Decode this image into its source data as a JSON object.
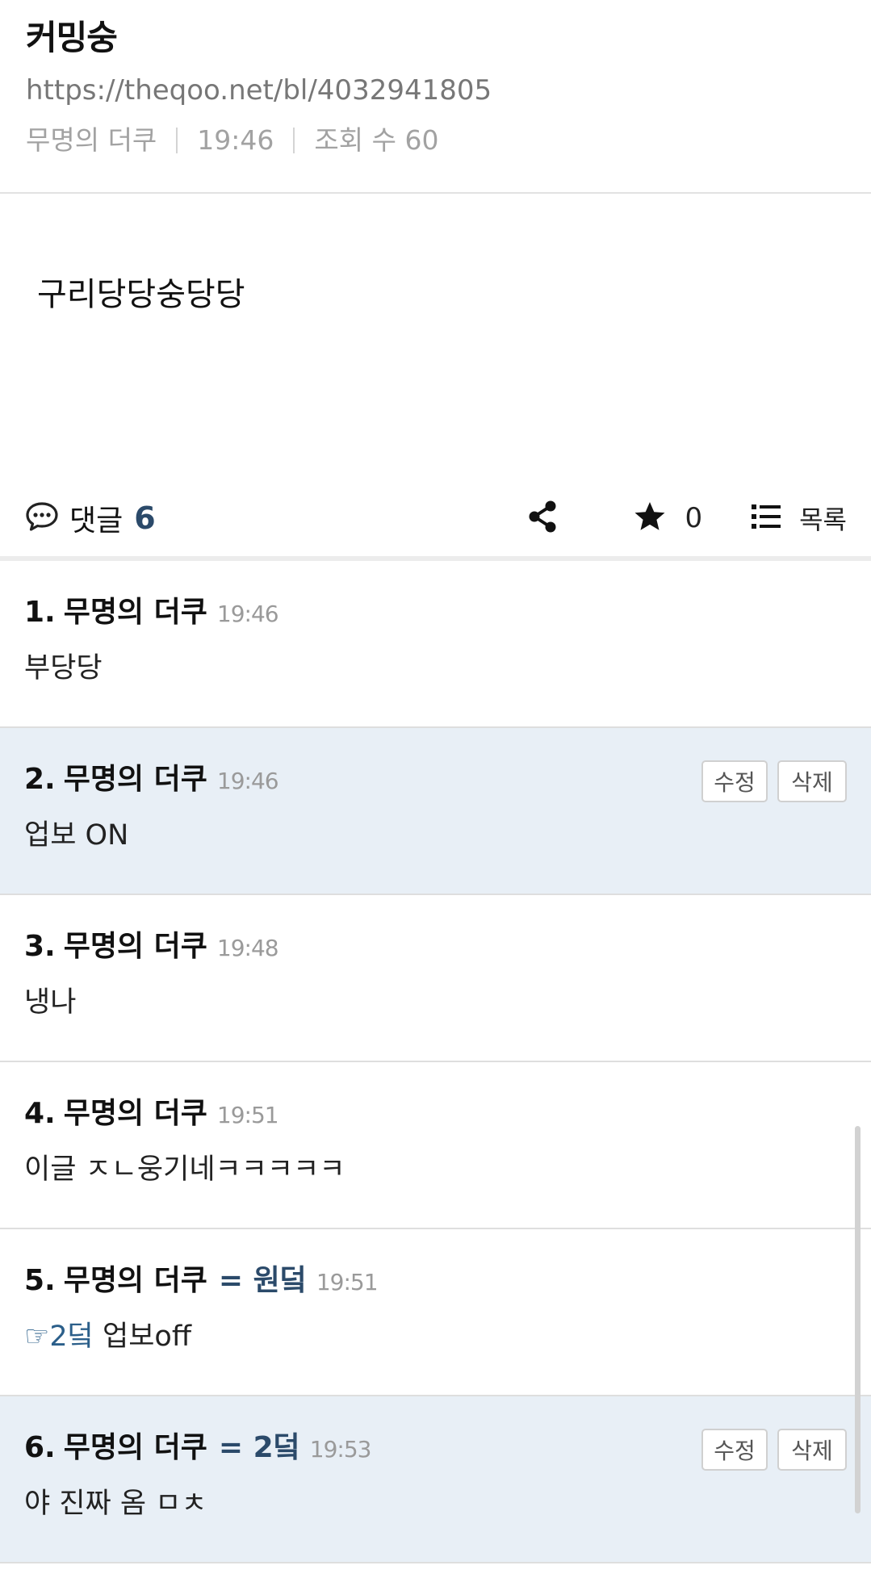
{
  "post": {
    "title": "커밍숭",
    "url": "https://theqoo.net/bl/4032941805",
    "author": "무명의 더쿠",
    "time": "19:46",
    "views": "조회 수 60",
    "content": "구리당당숭당당"
  },
  "actions": {
    "comment_label": "댓글",
    "comment_count": "6",
    "star_count": "0",
    "list_label": "목록"
  },
  "comments": [
    {
      "num": "1.",
      "author": "무명의 더쿠",
      "badge": "",
      "time": "19:46",
      "mention": "",
      "body": "부당당",
      "mine": false
    },
    {
      "num": "2.",
      "author": "무명의 더쿠",
      "badge": "",
      "time": "19:46",
      "mention": "",
      "body": "업보 ON",
      "mine": true,
      "edit_label": "수정",
      "delete_label": "삭제"
    },
    {
      "num": "3.",
      "author": "무명의 더쿠",
      "badge": "",
      "time": "19:48",
      "mention": "",
      "body": "냉나",
      "mine": false
    },
    {
      "num": "4.",
      "author": "무명의 더쿠",
      "badge": "",
      "time": "19:51",
      "mention": "",
      "body": "이글 ㅈㄴ웅기네ㅋㅋㅋㅋㅋ",
      "mine": false
    },
    {
      "num": "5.",
      "author": "무명의 더쿠",
      "badge": "= 원덬",
      "time": "19:51",
      "mention": "☞2덬",
      "body": "업보off",
      "mine": false
    },
    {
      "num": "6.",
      "author": "무명의 더쿠",
      "badge": "= 2덬",
      "time": "19:53",
      "mention": "",
      "body": "야 진짜 옴 ㅁㅊ",
      "mine": true,
      "edit_label": "수정",
      "delete_label": "삭제"
    }
  ],
  "colors": {
    "accent": "#2b4a6a",
    "mine_bg": "#e8eff6"
  }
}
